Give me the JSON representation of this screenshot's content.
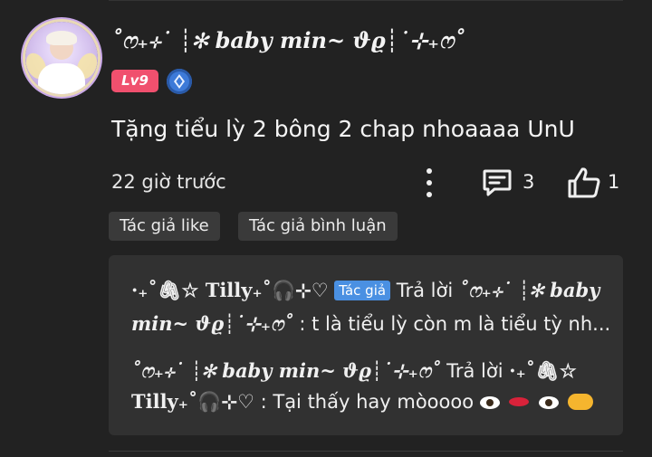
{
  "comment": {
    "username": "˚ෆ₊⊹˙ ┊✻ 𝒃𝒂𝒃𝒚 𝒎𝒊𝒏~ ϑϱ┊˙⊹₊ෆ˚",
    "level": "Lv9",
    "text": "Tặng tiểu lỳ 2 bông 2 chap nhoaaaa UnU",
    "timestamp": "22 giờ trước",
    "reply_count": "3",
    "like_count": "1"
  },
  "tags": {
    "author_like": "Tác giả like",
    "author_reply": "Tác giả bình luận"
  },
  "replies": [
    {
      "name": "·₊˚🖇☆ Tilly₊˚🎧⊹♡",
      "badge": "Tác giả",
      "verb": "Trả lời",
      "target_line1": "˚ෆ₊⊹˙ ┊✻ 𝒃𝒂𝒃𝒚",
      "target_line2": "𝒎𝒊𝒏~ ϑϱ┊˙⊹₊ෆ˚",
      "text": ": t là tiểu lỳ còn m là tiểu tỳ nh..."
    },
    {
      "name": "˚ෆ₊⊹˙ ┊✻ 𝒃𝒂𝒃𝒚 𝒎𝒊𝒏~ ϑϱ┊˙⊹₊ෆ˚",
      "verb": "Trả lời",
      "target_line1": "·₊˚🖇☆",
      "target_line2": "Tilly₊˚🎧⊹♡",
      "text": ": Tại thấy hay mòoooo"
    }
  ],
  "colors": {
    "background": "#222222",
    "level_badge": "#f0506e",
    "author_badge": "#4a90e2",
    "verified": "#3d7ad8"
  },
  "icons": [
    "verified-icon",
    "more-icon",
    "reply-icon",
    "like-icon"
  ]
}
